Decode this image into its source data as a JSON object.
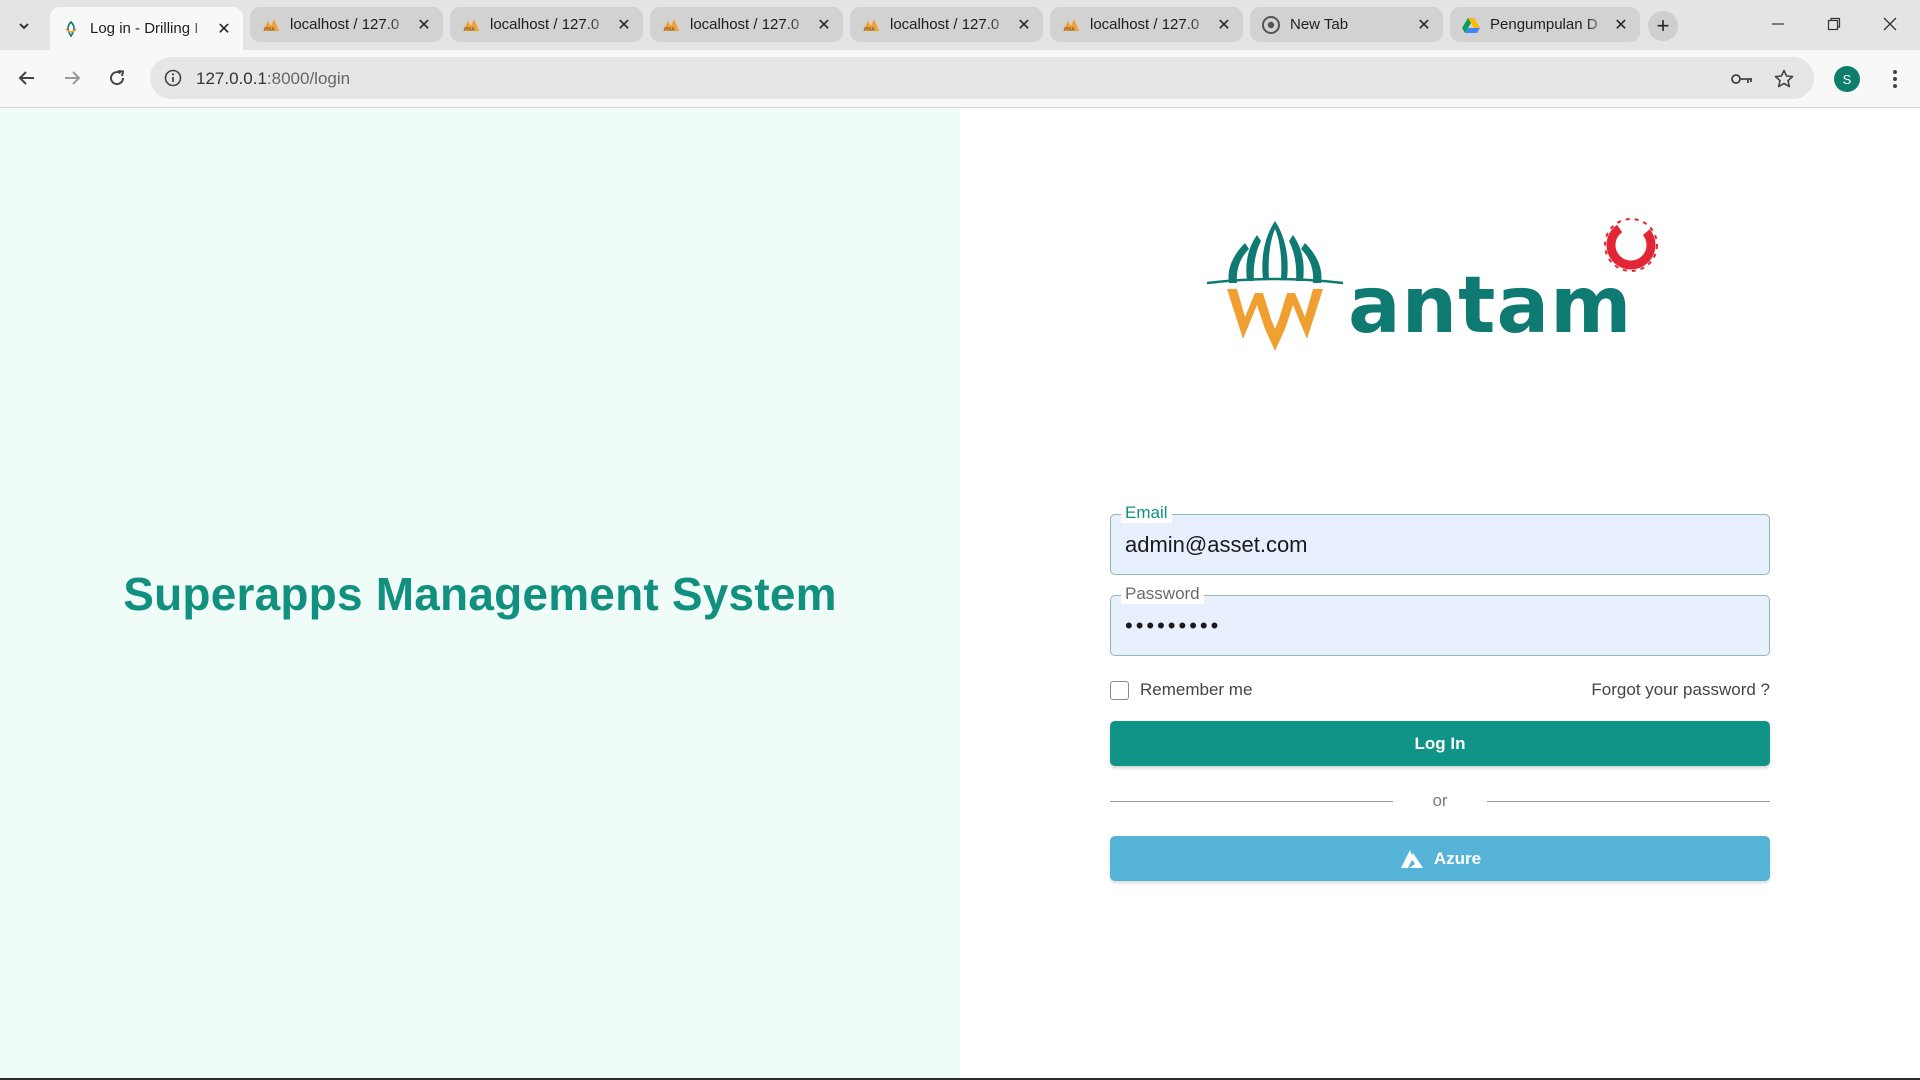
{
  "browser": {
    "tabs": [
      {
        "title": "Log in - Drilling I",
        "favicon": "antam-logo-icon",
        "active": true
      },
      {
        "title": "localhost / 127.0",
        "favicon": "phpmyadmin-icon",
        "active": false
      },
      {
        "title": "localhost / 127.0",
        "favicon": "phpmyadmin-icon",
        "active": false
      },
      {
        "title": "localhost / 127.0",
        "favicon": "phpmyadmin-icon",
        "active": false
      },
      {
        "title": "localhost / 127.0",
        "favicon": "phpmyadmin-icon",
        "active": false
      },
      {
        "title": "localhost / 127.0",
        "favicon": "phpmyadmin-icon",
        "active": false
      },
      {
        "title": "New Tab",
        "favicon": "chrome-icon",
        "active": false
      },
      {
        "title": "Pengumpulan D",
        "favicon": "google-drive-icon",
        "active": false
      }
    ],
    "url_host": "127.0.0.1",
    "url_path": ":8000/login",
    "profile_initial": "S"
  },
  "left": {
    "app_title": "Superapps Management System"
  },
  "logo": {
    "brand_text": "antam"
  },
  "form": {
    "email_label": "Email",
    "email_value": "admin@asset.com",
    "password_label": "Password",
    "password_value": "password1",
    "remember_label": "Remember me",
    "forgot_label": "Forgot your password ?",
    "login_label": "Log In",
    "or_label": "or",
    "azure_label": "Azure"
  },
  "colors": {
    "brand_teal": "#12907f",
    "login_button": "#0f9487",
    "azure_button": "#54b3d6",
    "left_panel_bg": "#effcf8",
    "logo_orange": "#f0a030",
    "logo_red": "#e32636"
  }
}
